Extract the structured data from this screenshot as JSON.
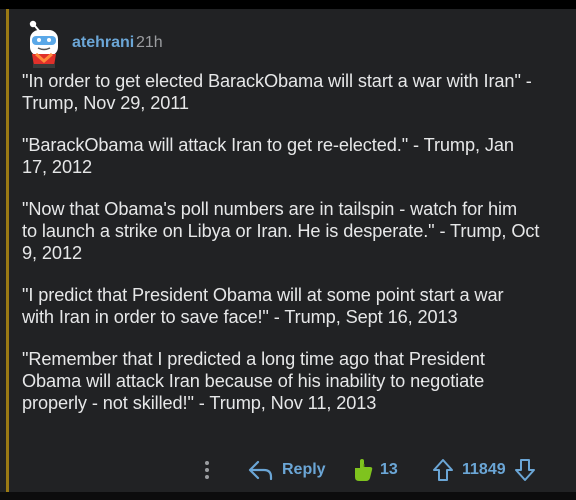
{
  "comment": {
    "author": "atehrani",
    "time_ago": "21h",
    "paragraphs": [
      "\"In order to get elected BarackObama will start a war with Iran\" -\nTrump, Nov 29, 2011",
      "\"BarackObama will attack Iran to get re-elected.\" - Trump, Jan\n17, 2012",
      "\"Now that Obama's poll numbers are in tailspin - watch for him\nto launch a strike on Libya or Iran. He is desperate.\" - Trump, Oct\n9, 2012",
      "\"I predict that President Obama will at some point start a war\nwith Iran in order to save face!\" - Trump, Sept 16, 2013",
      "\"Remember that I predicted a long time ago that President\nObama will attack Iran because of his inability to negotiate\nproperly - not skilled!\" - Trump, Nov 11, 2013"
    ]
  },
  "actions": {
    "reply_label": "Reply",
    "award_count": "13",
    "vote_count": "11849",
    "icons": {
      "more": "more-vertical-icon",
      "reply": "reply-arrow-icon",
      "award": "hand-award-icon",
      "upvote": "upvote-arrow-icon",
      "downvote": "downvote-arrow-icon"
    }
  },
  "colors": {
    "background": "#212224",
    "text": "#e6e7e8",
    "accent": "#6ba6d6",
    "muted": "#9b9da0",
    "thread_line": "#9a7a14",
    "award": "#7fc31e"
  }
}
